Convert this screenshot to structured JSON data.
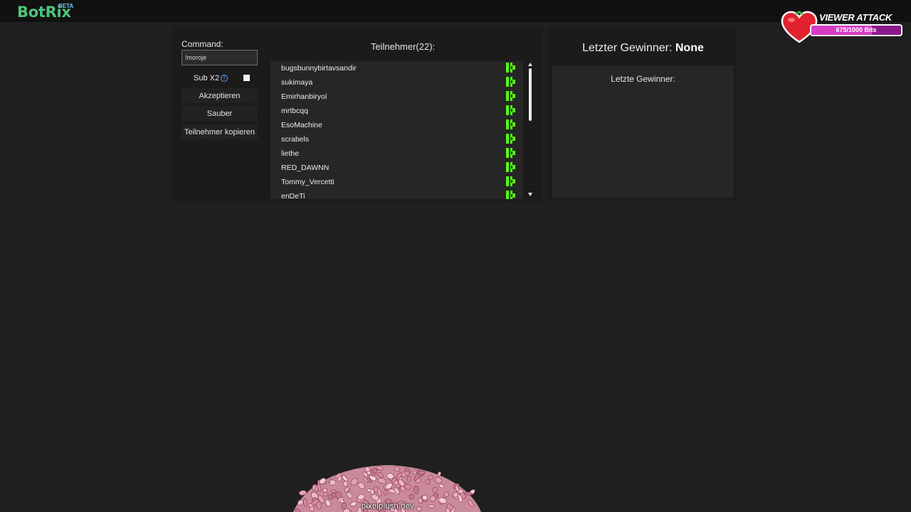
{
  "brand": {
    "name": "BotRix",
    "badge": "BETA",
    "color": "#4ec37a"
  },
  "form": {
    "command_label": "Command:",
    "command_value": "!moroje",
    "sub_label": "Sub X2",
    "sub_checked": false,
    "buttons": {
      "accept": "Akzeptieren",
      "clean": "Sauber",
      "copy": "Teilnehmer kopieren"
    }
  },
  "participants": {
    "title": "Teilnehmer(22):",
    "items": [
      {
        "name": "bugsbunnybirtavsandir",
        "platform_icon": "kick-icon"
      },
      {
        "name": "sukimaya",
        "platform_icon": "kick-icon"
      },
      {
        "name": "Emirhanbiryol",
        "platform_icon": "kick-icon"
      },
      {
        "name": "mrtbcqq",
        "platform_icon": "kick-icon"
      },
      {
        "name": "EsoMachine",
        "platform_icon": "kick-icon"
      },
      {
        "name": "scrabels",
        "platform_icon": "kick-icon"
      },
      {
        "name": "liethe",
        "platform_icon": "kick-icon"
      },
      {
        "name": "RED_DAWNN",
        "platform_icon": "kick-icon"
      },
      {
        "name": "Tommy_Vercetti",
        "platform_icon": "kick-icon"
      },
      {
        "name": "enDeTi",
        "platform_icon": "kick-icon"
      }
    ],
    "kick_color": "#53fc18"
  },
  "winner": {
    "title_prefix": "Letzter Gewinner:",
    "title_value": "None",
    "list_label": "Letzte Gewinner:"
  },
  "viewer_attack": {
    "title": "VIEWER ATTACK",
    "count_text": "675/1000 Bits",
    "progress": 0.675
  },
  "overlay": {
    "caption": "pixelplush.dev"
  }
}
